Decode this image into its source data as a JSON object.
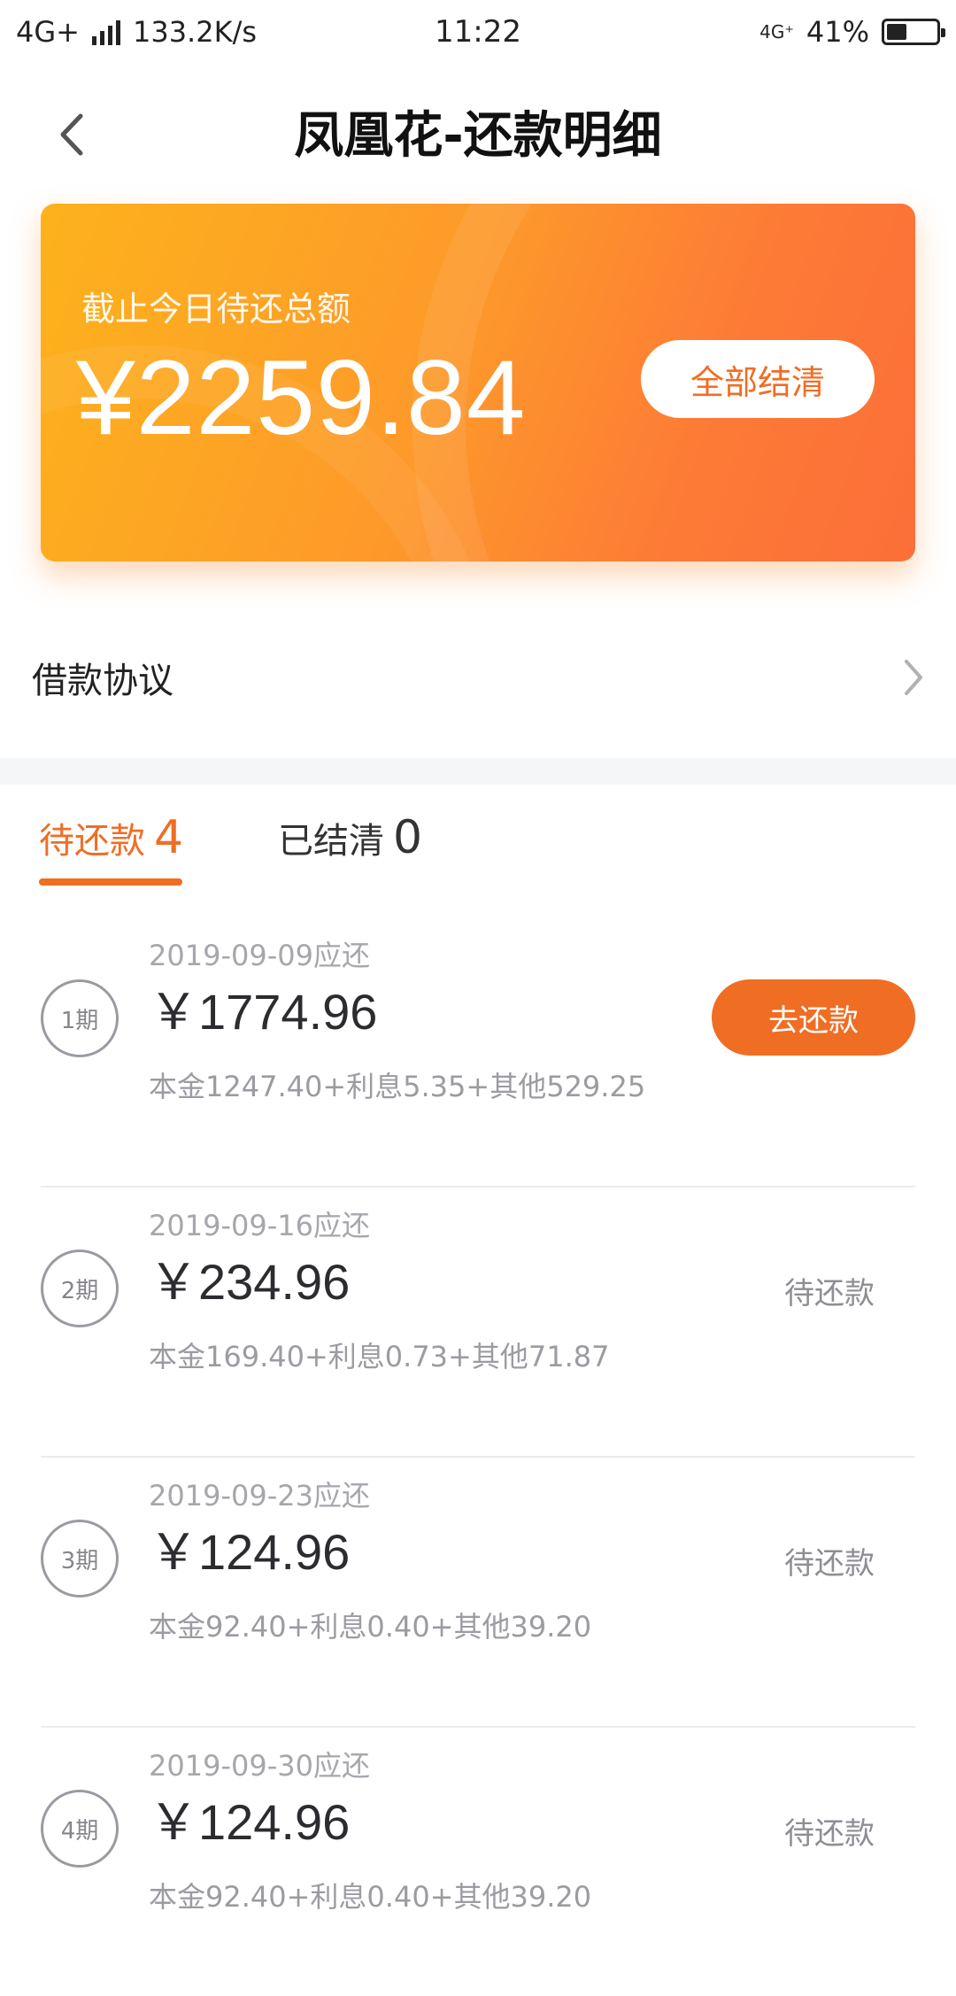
{
  "status_bar": {
    "network": "4G+",
    "speed": "133.2K/s",
    "time": "11:22",
    "net_badge": "4G⁺",
    "battery_percent": "41%",
    "battery_level": 0.41
  },
  "header": {
    "title": "凤凰花-还款明细",
    "back_icon": "chevron-left-icon"
  },
  "summary": {
    "label": "截止今日待还总额",
    "amount": "¥2259.84",
    "settle_label": "全部结清"
  },
  "agreement": {
    "label": "借款协议",
    "icon": "chevron-right-icon"
  },
  "tabs": {
    "pending": {
      "label": "待还款",
      "count": "4"
    },
    "settled": {
      "label": "已结清",
      "count": "0"
    },
    "active_color": "#f06d24"
  },
  "installments": [
    {
      "period": "1期",
      "due_date": "2019-09-09应还",
      "amount": "￥1774.96",
      "breakdown": "本金1247.40+利息5.35+其他529.25",
      "action": "去还款",
      "has_button": true
    },
    {
      "period": "2期",
      "due_date": "2019-09-16应还",
      "amount": "￥234.96",
      "breakdown": "本金169.40+利息0.73+其他71.87",
      "status": "待还款",
      "has_button": false
    },
    {
      "period": "3期",
      "due_date": "2019-09-23应还",
      "amount": "￥124.96",
      "breakdown": "本金92.40+利息0.40+其他39.20",
      "status": "待还款",
      "has_button": false
    },
    {
      "period": "4期",
      "due_date": "2019-09-30应还",
      "amount": "￥124.96",
      "breakdown": "本金92.40+利息0.40+其他39.20",
      "status": "待还款",
      "has_button": false
    }
  ],
  "colors": {
    "accent": "#f06d24",
    "card_gradient_start": "#fdb21c",
    "card_gradient_end": "#fb6f38"
  }
}
